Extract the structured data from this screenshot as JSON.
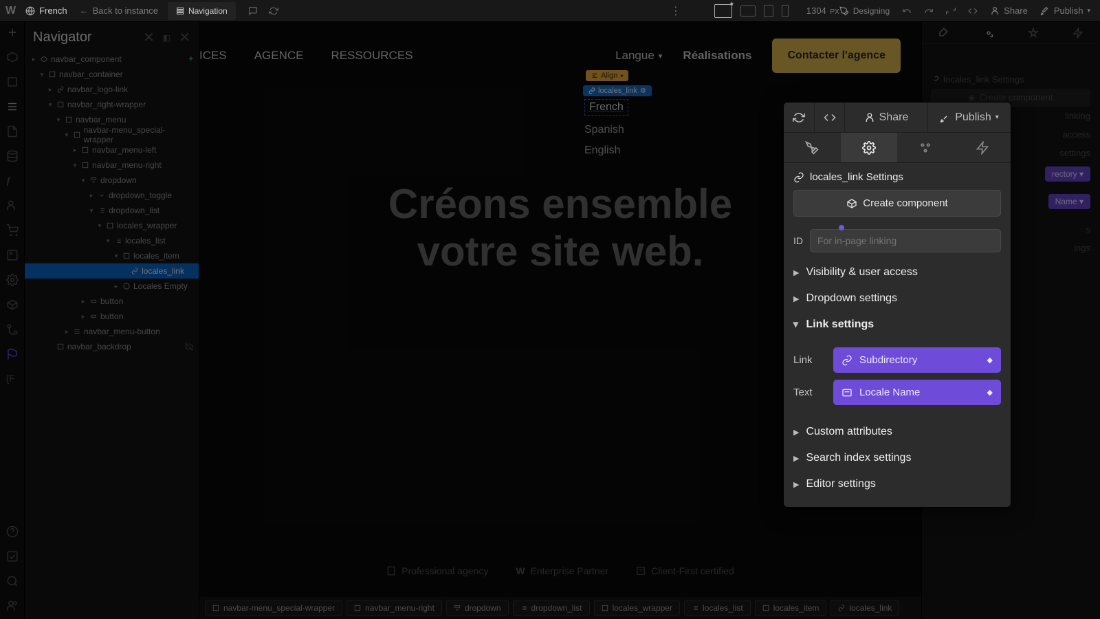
{
  "topbar": {
    "locale": "French",
    "back": "Back to instance",
    "active_page": "Navigation",
    "canvas_width": "1304",
    "canvas_unit": "PX",
    "mode": "Designing",
    "share": "Share",
    "publish": "Publish"
  },
  "navigator": {
    "title": "Navigator",
    "tree": [
      {
        "d": 0,
        "c": "▸",
        "ic": "component",
        "label": "navbar_component",
        "trail": [
          "dot",
          "plus"
        ]
      },
      {
        "d": 1,
        "c": "▾",
        "ic": "div",
        "label": "navbar_container"
      },
      {
        "d": 2,
        "c": "▸",
        "ic": "link",
        "label": "navbar_logo-link"
      },
      {
        "d": 2,
        "c": "▾",
        "ic": "div",
        "label": "navbar_right-wrapper"
      },
      {
        "d": 3,
        "c": "▾",
        "ic": "div",
        "label": "navbar_menu"
      },
      {
        "d": 4,
        "c": "▾",
        "ic": "div",
        "label": "navbar-menu_special-wrapper"
      },
      {
        "d": 5,
        "c": "▸",
        "ic": "div",
        "label": "navbar_menu-left"
      },
      {
        "d": 5,
        "c": "▾",
        "ic": "div",
        "label": "navbar_menu-right"
      },
      {
        "d": 6,
        "c": "▾",
        "ic": "dropdown",
        "label": "dropdown"
      },
      {
        "d": 7,
        "c": "▸",
        "ic": "toggle",
        "label": "dropdown_toggle"
      },
      {
        "d": 7,
        "c": "▾",
        "ic": "list",
        "label": "dropdown_list"
      },
      {
        "d": 8,
        "c": "▾",
        "ic": "div",
        "label": "locales_wrapper"
      },
      {
        "d": 9,
        "c": "▾",
        "ic": "list",
        "label": "locales_list"
      },
      {
        "d": 10,
        "c": "▾",
        "ic": "div",
        "label": "locales_item"
      },
      {
        "d": 11,
        "c": " ",
        "ic": "link",
        "label": "locales_link",
        "sel": true
      },
      {
        "d": 10,
        "c": "▸",
        "ic": "empty",
        "label": "Locales Empty"
      },
      {
        "d": 6,
        "c": "▸",
        "ic": "btn",
        "label": "button"
      },
      {
        "d": 6,
        "c": "▸",
        "ic": "btn",
        "label": "button"
      },
      {
        "d": 4,
        "c": "▸",
        "ic": "menu",
        "label": "navbar_menu-button"
      },
      {
        "d": 2,
        "c": " ",
        "ic": "div",
        "label": "navbar_backdrop",
        "trail": [
          "eye-off"
        ]
      }
    ]
  },
  "canvas": {
    "nav_links": [
      "ICES",
      "AGENCE",
      "RESSOURCES"
    ],
    "lang_label": "Langue",
    "real": "Réalisations",
    "cta": "Contacter l'agence",
    "align_badge": "Align",
    "locale_badge": "locales_link",
    "locales": {
      "current": "French",
      "others": [
        "Spanish",
        "English"
      ]
    },
    "hero_line1": "Créons ensemble",
    "hero_line2": "votre site web.",
    "badges": [
      "Professional agency",
      "Enterprise Partner",
      "Client-First certified"
    ]
  },
  "modal": {
    "share": "Share",
    "publish": "Publish",
    "title": "locales_link Settings",
    "create": "Create component",
    "id_label": "ID",
    "id_placeholder": "For in-page linking",
    "acc": {
      "vis": "Visibility & user access",
      "dd": "Dropdown settings",
      "link": "Link settings",
      "custom": "Custom attributes",
      "search": "Search index settings",
      "editor": "Editor settings"
    },
    "link_field": "Link",
    "link_value": "Subdirectory",
    "text_field": "Text",
    "text_value": "Locale Name"
  },
  "right_shadow": {
    "title": "locales_link Settings",
    "create": "Create component",
    "linking": "linking",
    "access": "access",
    "settings": "settings",
    "v1": "rectory",
    "v2": "Name",
    "s": "s",
    "ings": "ings"
  },
  "crumbs": [
    "navbar-menu_special-wrapper",
    "navbar_menu-right",
    "dropdown",
    "dropdown_list",
    "locales_wrapper",
    "locales_list",
    "locales_item",
    "locales_link"
  ]
}
